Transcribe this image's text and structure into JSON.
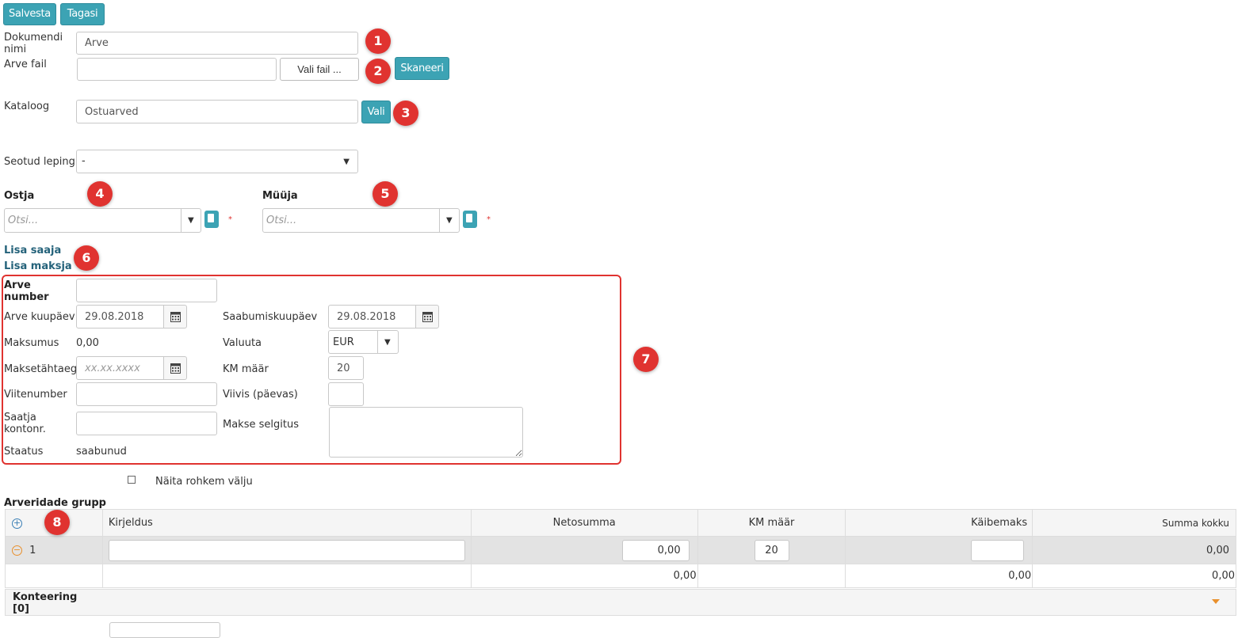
{
  "toolbar": {
    "save_label": "Salvesta",
    "back_label": "Tagasi"
  },
  "form": {
    "doc_name_label": "Dokumendi nimi",
    "doc_name_value": "Arve",
    "invoice_file_label": "Arve fail",
    "choose_file_label": "Vali fail ...",
    "scan_label": "Skaneeri",
    "catalog_label": "Kataloog",
    "catalog_value": "Ostuarved",
    "choose_label": "Vali",
    "contract_label": "Seotud leping",
    "contract_value": "-",
    "buyer_label": "Ostja",
    "buyer_placeholder": "Otsi...",
    "seller_label": "Müüja",
    "seller_placeholder": "Otsi...",
    "required_mark": "*",
    "add_recipient": "Lisa saaja",
    "add_payer": "Lisa maksja"
  },
  "invoice": {
    "number_label": "Arve number",
    "number_value": "",
    "date_label": "Arve kuupäev",
    "date_value": "29.08.2018",
    "arrival_label": "Saabumiskuupäev",
    "arrival_value": "29.08.2018",
    "cost_label": "Maksumus",
    "cost_value": "0,00",
    "currency_label": "Valuuta",
    "currency_value": "EUR",
    "due_label": "Maksetähtaeg",
    "due_placeholder": "xx.xx.xxxx",
    "vat_label": "KM määr",
    "vat_value": "20",
    "ref_label": "Viitenumber",
    "ref_value": "",
    "delay_label": "Viivis (päevas)",
    "delay_value": "",
    "sender_acct_label": "Saatja kontonr.",
    "sender_acct_value": "",
    "pay_desc_label": "Makse selgitus",
    "pay_desc_value": "",
    "status_label": "Staatus",
    "status_value": "saabunud"
  },
  "more_fields_label": "Näita rohkem välju",
  "rows_group": {
    "title": "Arveridade grupp",
    "columns": [
      "Kirjeldus",
      "Netosumma",
      "KM määr",
      "Käibemaks",
      "Summa kokku"
    ],
    "row": {
      "index": "1",
      "description": "",
      "net": "0,00",
      "vat_rate": "20",
      "vat": "",
      "total": "0,00"
    },
    "totals": {
      "net": "0,00",
      "vat": "0,00",
      "total": "0,00"
    }
  },
  "accounting": {
    "title": "Konteering [0]"
  },
  "badges": [
    "1",
    "2",
    "3",
    "4",
    "5",
    "6",
    "7",
    "8"
  ],
  "colors": {
    "accent": "#3ca3b4",
    "badge": "#e03330",
    "link": "#24627a",
    "highlight_border": "#e03330"
  }
}
